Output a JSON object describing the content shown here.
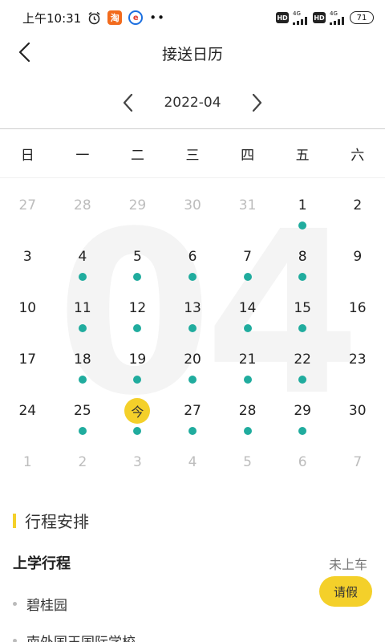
{
  "status_bar": {
    "time": "上午10:31",
    "taobao_icon": "淘",
    "network_1": "4G",
    "network_2": "4G",
    "hd_1": "HD",
    "hd_2": "HD",
    "battery": "71"
  },
  "header": {
    "title": "接送日历"
  },
  "calendar": {
    "month": "2022-04",
    "watermark": "04",
    "weekdays": [
      "日",
      "一",
      "二",
      "三",
      "四",
      "五",
      "六"
    ],
    "weeks": [
      [
        {
          "day": "27",
          "muted": true,
          "dot": false
        },
        {
          "day": "28",
          "muted": true,
          "dot": false
        },
        {
          "day": "29",
          "muted": true,
          "dot": false
        },
        {
          "day": "30",
          "muted": true,
          "dot": false
        },
        {
          "day": "31",
          "muted": true,
          "dot": false
        },
        {
          "day": "1",
          "muted": false,
          "dot": true
        },
        {
          "day": "2",
          "muted": false,
          "dot": false
        }
      ],
      [
        {
          "day": "3",
          "muted": false,
          "dot": false
        },
        {
          "day": "4",
          "muted": false,
          "dot": true
        },
        {
          "day": "5",
          "muted": false,
          "dot": true
        },
        {
          "day": "6",
          "muted": false,
          "dot": true
        },
        {
          "day": "7",
          "muted": false,
          "dot": true
        },
        {
          "day": "8",
          "muted": false,
          "dot": true
        },
        {
          "day": "9",
          "muted": false,
          "dot": false
        }
      ],
      [
        {
          "day": "10",
          "muted": false,
          "dot": false
        },
        {
          "day": "11",
          "muted": false,
          "dot": true
        },
        {
          "day": "12",
          "muted": false,
          "dot": true
        },
        {
          "day": "13",
          "muted": false,
          "dot": true
        },
        {
          "day": "14",
          "muted": false,
          "dot": true
        },
        {
          "day": "15",
          "muted": false,
          "dot": true
        },
        {
          "day": "16",
          "muted": false,
          "dot": false
        }
      ],
      [
        {
          "day": "17",
          "muted": false,
          "dot": false
        },
        {
          "day": "18",
          "muted": false,
          "dot": true
        },
        {
          "day": "19",
          "muted": false,
          "dot": true
        },
        {
          "day": "20",
          "muted": false,
          "dot": true
        },
        {
          "day": "21",
          "muted": false,
          "dot": true
        },
        {
          "day": "22",
          "muted": false,
          "dot": true
        },
        {
          "day": "23",
          "muted": false,
          "dot": false
        }
      ],
      [
        {
          "day": "24",
          "muted": false,
          "dot": false
        },
        {
          "day": "25",
          "muted": false,
          "dot": true
        },
        {
          "day": "今",
          "muted": false,
          "dot": true,
          "today": true
        },
        {
          "day": "27",
          "muted": false,
          "dot": true
        },
        {
          "day": "28",
          "muted": false,
          "dot": true
        },
        {
          "day": "29",
          "muted": false,
          "dot": true
        },
        {
          "day": "30",
          "muted": false,
          "dot": false
        }
      ],
      [
        {
          "day": "1",
          "muted": true,
          "dot": false
        },
        {
          "day": "2",
          "muted": true,
          "dot": false
        },
        {
          "day": "3",
          "muted": true,
          "dot": false
        },
        {
          "day": "4",
          "muted": true,
          "dot": false
        },
        {
          "day": "5",
          "muted": true,
          "dot": false
        },
        {
          "day": "6",
          "muted": true,
          "dot": false
        },
        {
          "day": "7",
          "muted": true,
          "dot": false
        }
      ]
    ]
  },
  "schedule": {
    "section_title": "行程安排",
    "trip_title": "上学行程",
    "trip_status": "未上车",
    "leave_button": "请假",
    "stops": [
      "碧桂园",
      "南外国王国际学校"
    ]
  },
  "colors": {
    "accent_yellow": "#f4d02a",
    "dot_teal": "#20ac9e",
    "muted_text": "#bdbdbd"
  }
}
